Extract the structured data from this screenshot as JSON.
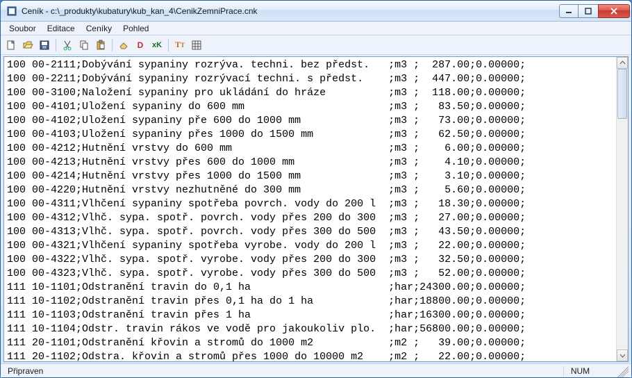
{
  "window": {
    "title": "Ceník - c:\\_produkty\\kubatury\\kub_kan_4\\CenikZemniPrace.cnk"
  },
  "menu": {
    "items": [
      "Soubor",
      "Editace",
      "Ceníky",
      "Pohled"
    ]
  },
  "toolbar": {
    "new": "new-file",
    "open": "open-file",
    "save": "save-file",
    "cut": "cut",
    "copy": "copy",
    "paste": "paste",
    "clear": "clear",
    "d_tool": "D",
    "xk_tool": "xK",
    "tt_tool": "Tт",
    "grid_tool": "grid"
  },
  "rows": [
    {
      "g": "100",
      "code": "00-2111",
      "desc": "Dobývání sypaniny rozrýva. techni. bez předst.",
      "unit": "m3 ",
      "price": "287.00",
      "factor": "0.00000"
    },
    {
      "g": "100",
      "code": "00-2211",
      "desc": "Dobývání sypaniny rozrývací techni. s předst.",
      "unit": "m3 ",
      "price": "447.00",
      "factor": "0.00000"
    },
    {
      "g": "100",
      "code": "00-3100",
      "desc": "Naložení sypaniny pro ukládání do hráze",
      "unit": "m3 ",
      "price": "118.00",
      "factor": "0.00000"
    },
    {
      "g": "100",
      "code": "00-4101",
      "desc": "Uložení sypaniny do 600 mm",
      "unit": "m3 ",
      "price": "83.50",
      "factor": "0.00000"
    },
    {
      "g": "100",
      "code": "00-4102",
      "desc": "Uložení sypaniny pře 600 do 1000 mm",
      "unit": "m3 ",
      "price": "73.00",
      "factor": "0.00000"
    },
    {
      "g": "100",
      "code": "00-4103",
      "desc": "Uložení sypaniny přes 1000 do 1500 mm",
      "unit": "m3 ",
      "price": "62.50",
      "factor": "0.00000"
    },
    {
      "g": "100",
      "code": "00-4212",
      "desc": "Hutnění vrstvy do 600 mm",
      "unit": "m3 ",
      "price": "6.00",
      "factor": "0.00000"
    },
    {
      "g": "100",
      "code": "00-4213",
      "desc": "Hutnění vrstvy přes 600 do 1000 mm",
      "unit": "m3 ",
      "price": "4.10",
      "factor": "0.00000"
    },
    {
      "g": "100",
      "code": "00-4214",
      "desc": "Hutnění vrstvy přes 1000 do 1500 mm",
      "unit": "m3 ",
      "price": "3.10",
      "factor": "0.00000"
    },
    {
      "g": "100",
      "code": "00-4220",
      "desc": "Hutnění vrstvy nezhutněné do 300 mm",
      "unit": "m3 ",
      "price": "5.60",
      "factor": "0.00000"
    },
    {
      "g": "100",
      "code": "00-4311",
      "desc": "Vlhčení sypaniny spotřeba povrch. vody do 200 l",
      "unit": "m3 ",
      "price": "18.30",
      "factor": "0.00000"
    },
    {
      "g": "100",
      "code": "00-4312",
      "desc": "Vlhč. sypa. spotř. povrch. vody přes 200 do 300",
      "unit": "m3 ",
      "price": "27.00",
      "factor": "0.00000"
    },
    {
      "g": "100",
      "code": "00-4313",
      "desc": "Vlhč. sypa. spotř. povrch. vody přes 300 do 500",
      "unit": "m3 ",
      "price": "43.50",
      "factor": "0.00000"
    },
    {
      "g": "100",
      "code": "00-4321",
      "desc": "Vlhčení sypaniny spotřeba vyrobe. vody do 200 l",
      "unit": "m3 ",
      "price": "22.00",
      "factor": "0.00000"
    },
    {
      "g": "100",
      "code": "00-4322",
      "desc": "Vlhč. sypa. spotř. vyrobe. vody přes 200 do 300",
      "unit": "m3 ",
      "price": "32.50",
      "factor": "0.00000"
    },
    {
      "g": "100",
      "code": "00-4323",
      "desc": "Vlhč. sypa. spotř. vyrobe. vody přes 300 do 500",
      "unit": "m3 ",
      "price": "52.00",
      "factor": "0.00000"
    },
    {
      "g": "111",
      "code": "10-1101",
      "desc": "Odstranění travin do 0,1 ha",
      "unit": "har",
      "price": "24300.00",
      "factor": "0.00000"
    },
    {
      "g": "111",
      "code": "10-1102",
      "desc": "Odstranění travin přes 0,1 ha do 1 ha",
      "unit": "har",
      "price": "18800.00",
      "factor": "0.00000"
    },
    {
      "g": "111",
      "code": "10-1103",
      "desc": "Odstranění travin přes 1 ha",
      "unit": "har",
      "price": "16300.00",
      "factor": "0.00000"
    },
    {
      "g": "111",
      "code": "10-1104",
      "desc": "Odstr. travin rákos ve vodě pro jakoukoliv plo.",
      "unit": "har",
      "price": "56800.00",
      "factor": "0.00000"
    },
    {
      "g": "111",
      "code": "20-1101",
      "desc": "Odstranění křovin a stromů do 1000 m2",
      "unit": "m2 ",
      "price": "39.00",
      "factor": "0.00000"
    },
    {
      "g": "111",
      "code": "20-1102",
      "desc": "Odstra. křovin a stromů přes 1000 do 10000 m2",
      "unit": "m2 ",
      "price": "22.00",
      "factor": "0.00000"
    }
  ],
  "status": {
    "left": "Připraven",
    "num": "NUM"
  },
  "layout": {
    "desc_width": 47,
    "price_width": 8
  }
}
